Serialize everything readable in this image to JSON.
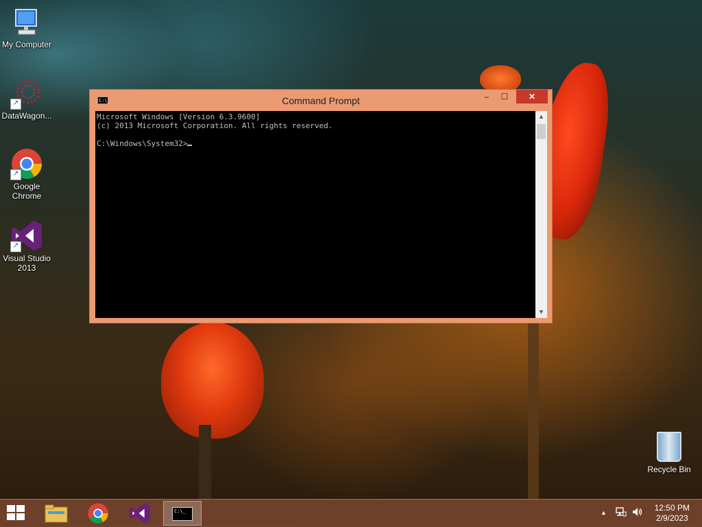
{
  "desktop": {
    "icons": [
      {
        "label": "My Computer",
        "icon": "computer-icon"
      },
      {
        "label": "DataWagon...",
        "icon": "datawagon-icon"
      },
      {
        "label": "Google Chrome",
        "icon": "chrome-icon"
      },
      {
        "label": "Visual Studio 2013",
        "icon": "visual-studio-icon"
      }
    ],
    "recycle_bin": {
      "label": "Recycle Bin",
      "icon": "recycle-bin-icon"
    }
  },
  "window": {
    "title": "Command Prompt",
    "icon": "cmd-icon",
    "icon_text": "C:\\_",
    "controls": {
      "minimize": "–",
      "maximize": "☐",
      "close": "✕"
    },
    "console_lines": [
      "Microsoft Windows [Version 6.3.9600]",
      "(c) 2013 Microsoft Corporation. All rights reserved.",
      "",
      "C:\\Windows\\System32>"
    ],
    "scrollbar": {
      "up": "▲",
      "down": "▼"
    }
  },
  "taskbar": {
    "start": "start-icon",
    "items": [
      {
        "name": "file-explorer",
        "icon": "folder-icon",
        "active": false
      },
      {
        "name": "chrome",
        "icon": "chrome-icon",
        "active": false
      },
      {
        "name": "visual-studio",
        "icon": "visual-studio-icon",
        "active": false
      },
      {
        "name": "command-prompt",
        "icon": "cmd-icon",
        "active": true
      }
    ],
    "tray": {
      "show_hidden": "▲",
      "network": "network-icon",
      "volume": "volume-icon"
    },
    "clock": {
      "time": "12:50 PM",
      "date": "2/9/2023"
    }
  },
  "colors": {
    "window_frame": "#ec9a72",
    "close_button": "#c7372a",
    "console_bg": "#000000",
    "console_text": "#c0c0c0",
    "taskbar": "#78462d"
  }
}
